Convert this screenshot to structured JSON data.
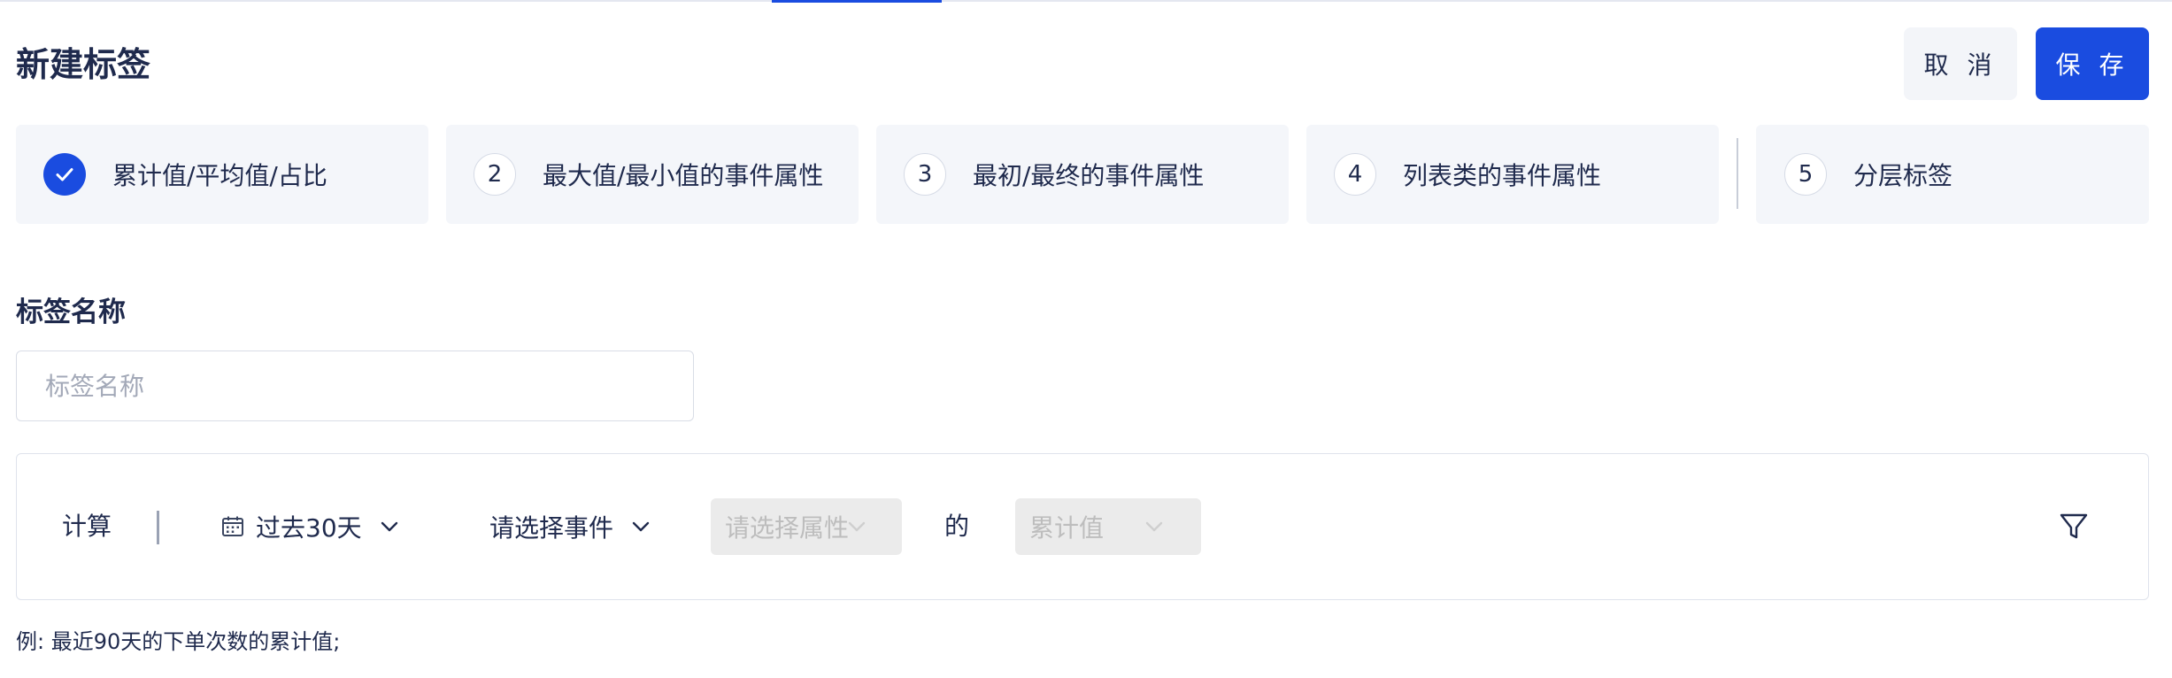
{
  "header": {
    "title": "新建标签",
    "cancel_label": "取 消",
    "save_label": "保 存"
  },
  "steps": [
    {
      "num": "",
      "label": "累计值/平均值/占比",
      "done": true
    },
    {
      "num": "2",
      "label": "最大值/最小值的事件属性"
    },
    {
      "num": "3",
      "label": "最初/最终的事件属性"
    },
    {
      "num": "4",
      "label": "列表类的事件属性"
    },
    {
      "num": "5",
      "label": "分层标签"
    }
  ],
  "name_section": {
    "label": "标签名称",
    "placeholder": "标签名称",
    "value": ""
  },
  "calc": {
    "label": "计算",
    "date_range": "过去30天",
    "event_placeholder": "请选择事件",
    "property_placeholder": "请选择属性",
    "connector": "的",
    "aggregation": "累计值"
  },
  "example": "例: 最近90天的下单次数的累计值;",
  "colors": {
    "accent": "#1a4ce0",
    "text": "#1f2a4d",
    "step_bg": "#f4f6fa",
    "disabled_bg": "#ebebeb"
  },
  "icons": [
    "check-icon",
    "calendar-icon",
    "chevron-down-icon",
    "filter-icon"
  ]
}
